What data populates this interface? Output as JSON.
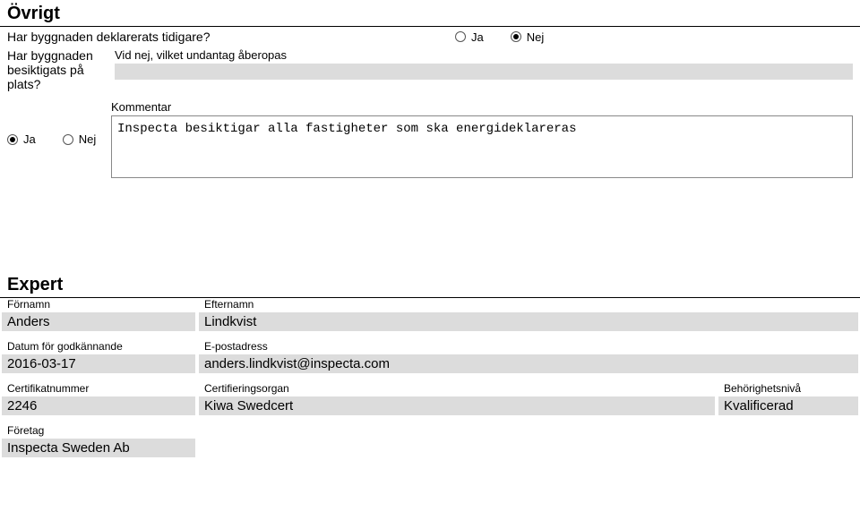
{
  "ovrigt": {
    "title": "Övrigt",
    "q1": "Har byggnaden deklarerats tidigare?",
    "q1_ja": "Ja",
    "q1_nej": "Nej",
    "q2_line1": "Har byggnaden",
    "q2_line2": "besiktigats på plats?",
    "q2_exception_label": "Vid nej, vilket undantag åberopas",
    "q2_exception_value": "",
    "q3_ja": "Ja",
    "q3_nej": "Nej",
    "kommentar_label": "Kommentar",
    "kommentar_value": "Inspecta besiktigar alla fastigheter som ska energideklareras"
  },
  "expert": {
    "title": "Expert",
    "fornamn_label": "Förnamn",
    "fornamn_value": "Anders",
    "efternamn_label": "Efternamn",
    "efternamn_value": "Lindkvist",
    "datum_label": "Datum för godkännande",
    "datum_value": "2016-03-17",
    "epost_label": "E-postadress",
    "epost_value": "anders.lindkvist@inspecta.com",
    "cert_label": "Certifikatnummer",
    "cert_value": "2246",
    "organ_label": "Certifieringsorgan",
    "organ_value": "Kiwa Swedcert",
    "niva_label": "Behörighetsnivå",
    "niva_value": "Kvalificerad",
    "foretag_label": "Företag",
    "foretag_value": "Inspecta Sweden Ab"
  }
}
